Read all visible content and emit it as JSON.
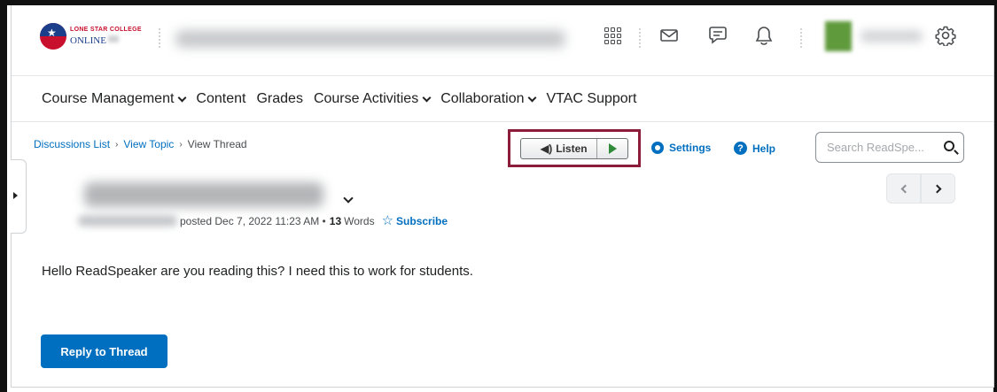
{
  "header": {
    "logo_line1": "LONE STAR COLLEGE",
    "logo_line2": "ONLINE",
    "icons": [
      "apps-grid-icon",
      "mail-icon",
      "message-icon",
      "bell-icon",
      "gear-icon"
    ]
  },
  "nav": {
    "items": [
      {
        "label": "Course Management",
        "dropdown": true
      },
      {
        "label": "Content",
        "dropdown": false
      },
      {
        "label": "Grades",
        "dropdown": false
      },
      {
        "label": "Course Activities",
        "dropdown": true
      },
      {
        "label": "Collaboration",
        "dropdown": true
      },
      {
        "label": "VTAC Support",
        "dropdown": false
      }
    ]
  },
  "breadcrumb": {
    "items": [
      "Discussions List",
      "View Topic"
    ],
    "current": "View Thread"
  },
  "readspeaker": {
    "listen_label": "Listen",
    "settings_label": "Settings",
    "help_label": "Help",
    "search_placeholder": "Search ReadSpe...",
    "highlight_color": "#8c1d3a"
  },
  "thread": {
    "posted_text": "posted Dec 7, 2022 11:23 AM •",
    "word_count": "13",
    "words_label": "Words",
    "subscribe_label": "Subscribe",
    "body": "Hello ReadSpeaker are you reading this?  I need this to work for students.",
    "reply_label": "Reply to Thread"
  },
  "colors": {
    "accent": "#006fbf",
    "play_green": "#2f8a3a"
  }
}
